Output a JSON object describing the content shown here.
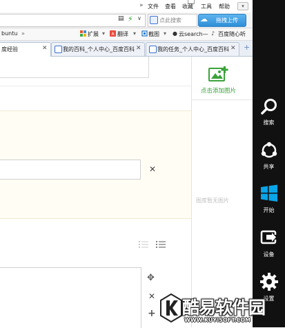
{
  "menubar": {
    "arrows": "»",
    "items": [
      "文件",
      "查看",
      "收藏",
      "工具",
      "帮助"
    ]
  },
  "address": {
    "search_placeholder": "点此搜索",
    "upload_label": "拖拽上传"
  },
  "bookmarks": {
    "chevron": "»",
    "items": [
      "buntu",
      "扩展",
      "翻译",
      "截图",
      "云search—",
      "百度随心听"
    ]
  },
  "tabs": [
    {
      "label": "度经验",
      "active": true
    },
    {
      "label": "我的百科_个人中心_百度百科",
      "active": false
    },
    {
      "label": "我的任务_个人中心_百度百科",
      "active": false
    }
  ],
  "gallery": {
    "add_label": "点击添加图片",
    "empty_text": "图库暂无图片"
  },
  "charms": [
    {
      "icon": "search-icon",
      "label": "搜索"
    },
    {
      "icon": "share-icon",
      "label": "共享"
    },
    {
      "icon": "windows-start-icon",
      "label": "开始"
    },
    {
      "icon": "devices-icon",
      "label": "设备"
    },
    {
      "icon": "settings-icon",
      "label": "设置"
    }
  ],
  "watermark": {
    "text": "酷易软件园",
    "url": "WWW.KUYISOFT.COM"
  },
  "colors": {
    "accent_green": "#3aa23a",
    "charm_bg": "#111111",
    "upload_blue": "#2f8fd8"
  }
}
